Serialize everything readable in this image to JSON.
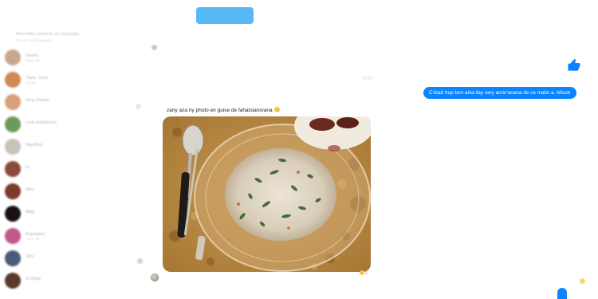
{
  "top_button": {
    "label": ""
  },
  "sidebar": {
    "header_title": "Nouvelles contacts sur message",
    "header_sub": "Envoyé via Messenger",
    "conversations": [
      {
        "name": "Sandra",
        "snippet": "Vous: ok",
        "color": "#c9a68f"
      },
      {
        "name": "Tiana · Vous",
        "snippet": "20 déc",
        "color": "#d08a55"
      },
      {
        "name": "Vonjy Rakoto",
        "snippet": "",
        "color": "#d9a07a"
      },
      {
        "name": "Lucie Andriamaro",
        "snippet": "",
        "color": "#6c9a5a"
      },
      {
        "name": "Haja Rivo",
        "snippet": "",
        "color": "#c8c2ba"
      },
      {
        "name": "Fy",
        "snippet": "",
        "color": "#8a4a3a"
      },
      {
        "name": "Hery",
        "snippet": "",
        "color": "#7a3a2a"
      },
      {
        "name": "Mialy",
        "snippet": "",
        "color": "#1a1212"
      },
      {
        "name": "Rojoniaina",
        "snippet": "Vous: ok",
        "color": "#c2588a"
      },
      {
        "name": "Tsiry",
        "snippet": "",
        "color": "#4a5a7a"
      },
      {
        "name": "Zo Rabe",
        "snippet": "",
        "color": "#5a3a2a"
      }
    ]
  },
  "chat": {
    "timestamp": "14:41",
    "sent_message": "C'était trop bon akia ilay vary amin'anana de ce matin a. Misotr",
    "photo_caption": "zany aza ny photo en guise de fahatsiarovana",
    "reaction_count": "1",
    "like_icon": "thumbs-up-icon",
    "accent": "#0a84ff"
  }
}
